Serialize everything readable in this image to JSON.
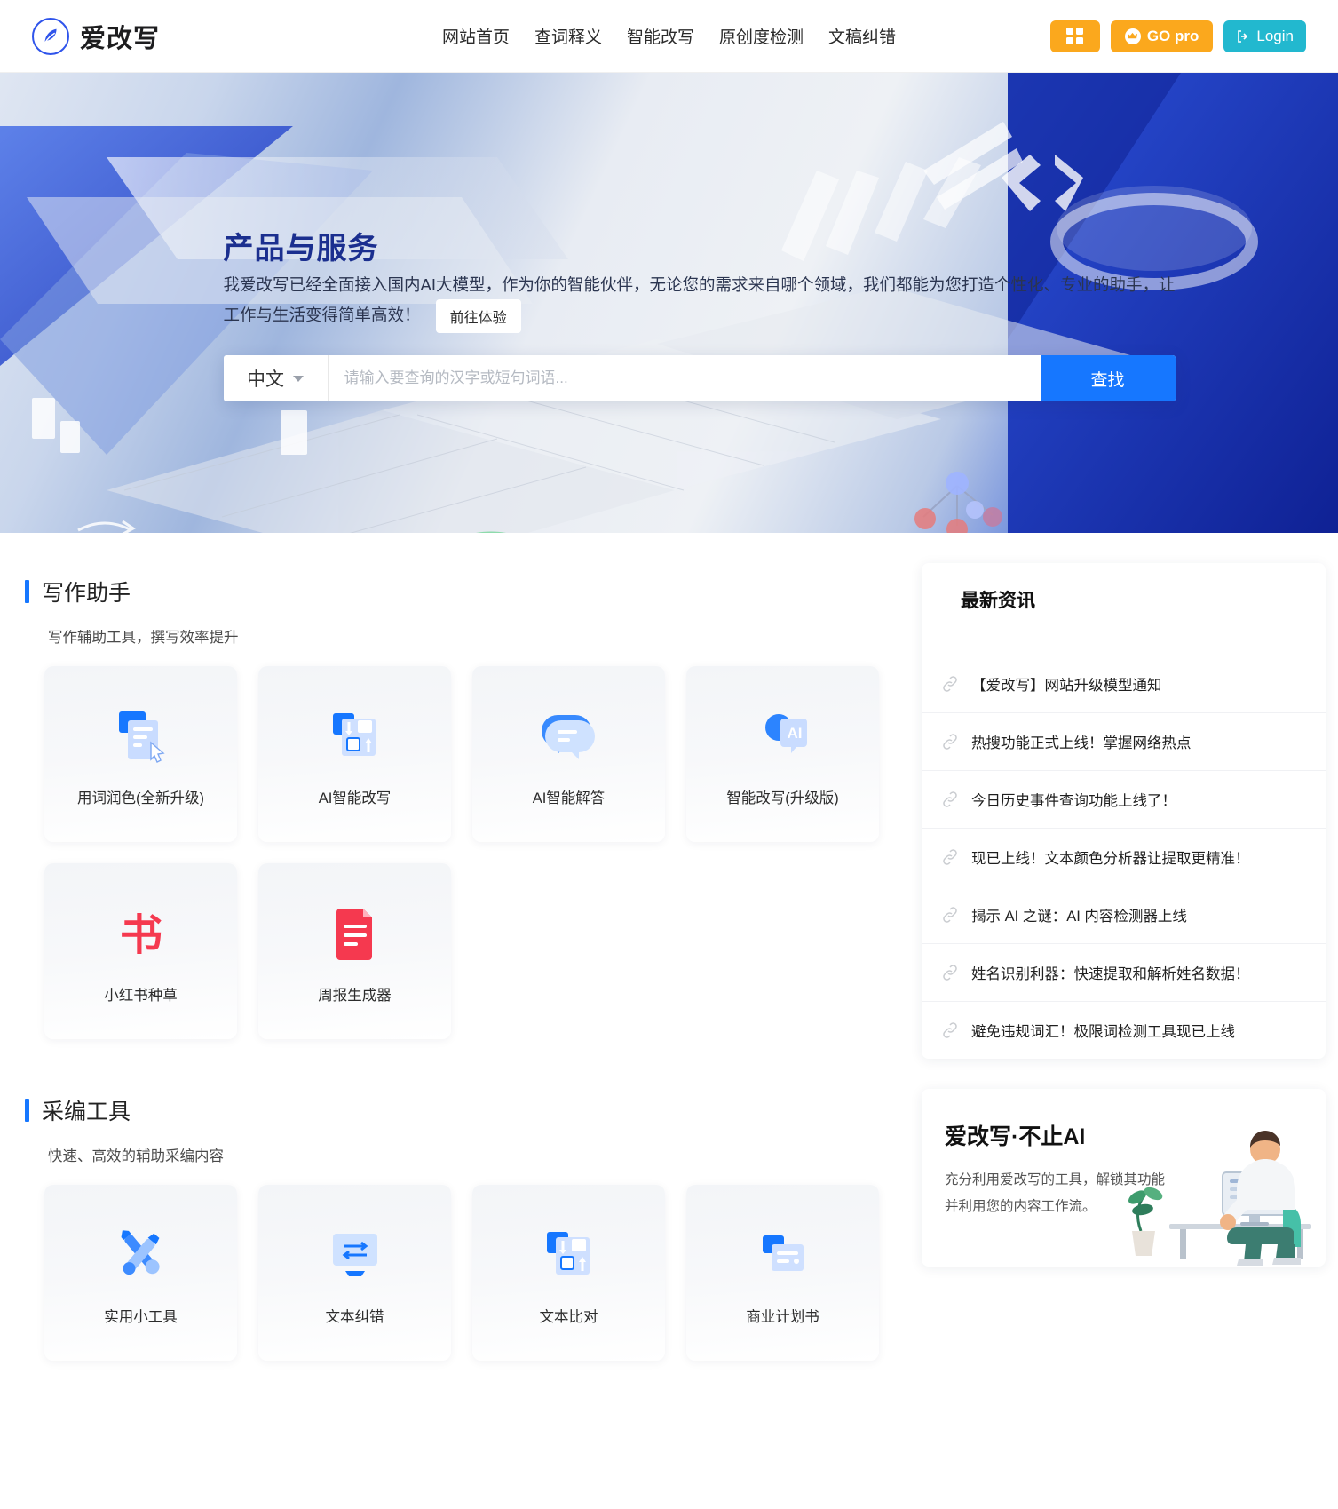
{
  "header": {
    "brand_name": "爱改写",
    "brand_icon": "feather-logo-icon",
    "nav": [
      {
        "label": "网站首页"
      },
      {
        "label": "查词释义"
      },
      {
        "label": "智能改写"
      },
      {
        "label": "原创度检测"
      },
      {
        "label": "文稿纠错"
      }
    ],
    "grid_button_icon": "apps-grid-icon",
    "pro_label": "GO pro",
    "login_label": "Login",
    "accent_orange": "#fba81d",
    "accent_cyan": "#22b8cf",
    "accent_blue": "#1677ff"
  },
  "hero": {
    "title": "产品与服务",
    "description": "我爱改写已经全面接入国内AI大模型，作为你的智能伙伴，无论您的需求来自哪个领域，我们都能为您打造个性化、专业的助手，让工作与生活变得简单高效！",
    "cta_label": "前往体验",
    "search": {
      "language": "中文",
      "placeholder": "请输入要查询的汉字或短句词语...",
      "value": "",
      "button_label": "查找"
    }
  },
  "sections": [
    {
      "title": "写作助手",
      "subtitle": "写作辅助工具，撰写效率提升",
      "cards": [
        {
          "label": "用词润色(全新升级)",
          "icon": "document-cursor-icon"
        },
        {
          "label": "AI智能改写",
          "icon": "rewrite-arrows-icon"
        },
        {
          "label": "AI智能解答",
          "icon": "chat-bubble-icon"
        },
        {
          "label": "智能改写(升级版)",
          "icon": "ai-bubble-icon"
        },
        {
          "label": "小红书种草",
          "icon": "xiaohongshu-book-icon"
        },
        {
          "label": "周报生成器",
          "icon": "report-document-icon"
        }
      ]
    },
    {
      "title": "采编工具",
      "subtitle": "快速、高效的辅助采编内容",
      "cards": [
        {
          "label": "实用小工具",
          "icon": "wrench-screwdriver-icon"
        },
        {
          "label": "文本纠错",
          "icon": "monitor-swap-icon"
        },
        {
          "label": "文本比对",
          "icon": "compare-arrows-icon"
        },
        {
          "label": "商业计划书",
          "icon": "business-plan-icon"
        }
      ]
    }
  ],
  "news": {
    "title": "最新资讯",
    "item_icon": "link-chain-icon",
    "items": [
      {
        "label": "【爱改写】网站升级模型通知"
      },
      {
        "label": "热搜功能正式上线！掌握网络热点"
      },
      {
        "label": "今日历史事件查询功能上线了！"
      },
      {
        "label": "现已上线！文本颜色分析器让提取更精准！"
      },
      {
        "label": "揭示 AI 之谜：AI 内容检测器上线"
      },
      {
        "label": "姓名识别利器：快速提取和解析姓名数据！"
      },
      {
        "label": "避免违规词汇！极限词检测工具现已上线"
      }
    ]
  },
  "promo": {
    "title": "爱改写·不止AI",
    "text": "充分利用爱改写的工具，解锁其功能并利用您的内容工作流。",
    "art_icon": "person-at-desk-illustration"
  }
}
